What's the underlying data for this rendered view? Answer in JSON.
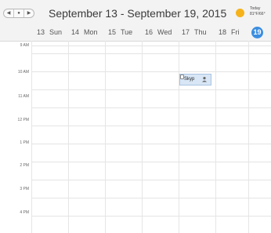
{
  "nav": {
    "prev": "◀",
    "today": "●",
    "next": "▶"
  },
  "title": "September 13 - September 19, 2015",
  "weather": {
    "line1": "Today",
    "line2": "81°F/66°"
  },
  "days": [
    {
      "num": "13",
      "name": "Sun"
    },
    {
      "num": "14",
      "name": "Mon"
    },
    {
      "num": "15",
      "name": "Tue"
    },
    {
      "num": "16",
      "name": "Wed"
    },
    {
      "num": "17",
      "name": "Thu"
    },
    {
      "num": "18",
      "name": "Fri"
    },
    {
      "num": "19",
      "name": ""
    }
  ],
  "times": [
    "9 AM",
    "10 AM",
    "11 AM",
    "12 PM",
    "1 PM",
    "2 PM",
    "3 PM",
    "4 PM"
  ],
  "event": {
    "label": "Skyp"
  },
  "colors": {
    "today": "#3b8ee0",
    "event_fill": "#d8e6f5",
    "sun": "#f6b21b"
  }
}
